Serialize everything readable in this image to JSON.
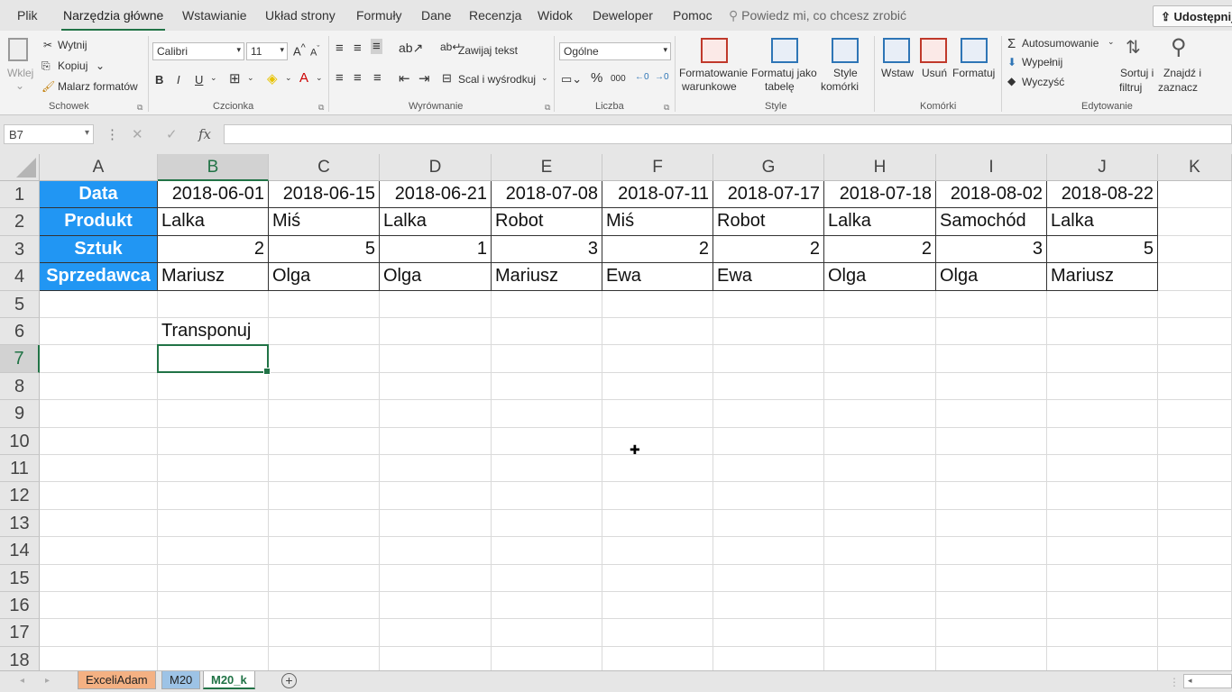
{
  "menu": {
    "tabs": [
      "Plik",
      "Narzędzia główne",
      "Wstawianie",
      "Układ strony",
      "Formuły",
      "Dane",
      "Recenzja",
      "Widok",
      "Deweloper",
      "Pomoc"
    ],
    "active_tab": "Narzędzia główne",
    "tell_me": "Powiedz mi, co chcesz zrobić",
    "share": "Udostępnij"
  },
  "ribbon": {
    "clipboard": {
      "label": "Schowek",
      "paste": "Wklej",
      "cut": "Wytnij",
      "copy": "Kopiuj",
      "format_painter": "Malarz formatów"
    },
    "font": {
      "label": "Czcionka",
      "font_name": "Calibri",
      "font_size": "11",
      "bold": "B",
      "italic": "I",
      "underline": "U"
    },
    "alignment": {
      "label": "Wyrównanie",
      "wrap_text": "Zawijaj tekst",
      "merge_center": "Scal i wyśrodkuj"
    },
    "number": {
      "label": "Liczba",
      "format": "Ogólne"
    },
    "styles": {
      "label": "Style",
      "conditional_line1": "Formatowanie",
      "conditional_line2": "warunkowe",
      "table_line1": "Formatuj jako",
      "table_line2": "tabelę",
      "cell_styles_line1": "Style",
      "cell_styles_line2": "komórki"
    },
    "cells": {
      "label": "Komórki",
      "insert": "Wstaw",
      "delete": "Usuń",
      "format": "Formatuj"
    },
    "editing": {
      "label": "Edytowanie",
      "autosum": "Autosumowanie",
      "fill": "Wypełnij",
      "clear": "Wyczyść",
      "sort_line1": "Sortuj i",
      "sort_line2": "filtruj",
      "find_line1": "Znajdź i",
      "find_line2": "zaznacz"
    }
  },
  "formula_bar": {
    "name_box": "B7",
    "fx": "fx",
    "content": ""
  },
  "sheet": {
    "columns": [
      "A",
      "B",
      "C",
      "D",
      "E",
      "F",
      "G",
      "H",
      "I",
      "J",
      "K"
    ],
    "rows": [
      "1",
      "2",
      "3",
      "4",
      "5",
      "6",
      "7",
      "8",
      "9",
      "10",
      "11",
      "12",
      "13",
      "14",
      "15",
      "16",
      "17",
      "18"
    ],
    "selected_column": "B",
    "selected_row": "7",
    "headers": [
      "Data",
      "Produkt",
      "Sztuk",
      "Sprzedawca"
    ],
    "records": [
      {
        "date": "2018-06-01",
        "product": "Lalka",
        "qty": "2",
        "seller": "Mariusz"
      },
      {
        "date": "2018-06-15",
        "product": "Miś",
        "qty": "5",
        "seller": "Olga"
      },
      {
        "date": "2018-06-21",
        "product": "Lalka",
        "qty": "1",
        "seller": "Olga"
      },
      {
        "date": "2018-07-08",
        "product": "Robot",
        "qty": "3",
        "seller": "Mariusz"
      },
      {
        "date": "2018-07-11",
        "product": "Miś",
        "qty": "2",
        "seller": "Ewa"
      },
      {
        "date": "2018-07-17",
        "product": "Robot",
        "qty": "2",
        "seller": "Ewa"
      },
      {
        "date": "2018-07-18",
        "product": "Lalka",
        "qty": "2",
        "seller": "Olga"
      },
      {
        "date": "2018-08-02",
        "product": "Samochód",
        "qty": "3",
        "seller": "Olga"
      },
      {
        "date": "2018-08-22",
        "product": "Lalka",
        "qty": "5",
        "seller": "Mariusz"
      }
    ],
    "b6": "Transponuj",
    "header_color": "#2196f3"
  },
  "sheet_tabs": [
    {
      "name": "ExceliAdam",
      "color": "#f4b183"
    },
    {
      "name": "M20",
      "color": "#9dc3e6"
    },
    {
      "name": "M20_k",
      "color": "#ffffff"
    }
  ],
  "active_sheet": "M20_k"
}
